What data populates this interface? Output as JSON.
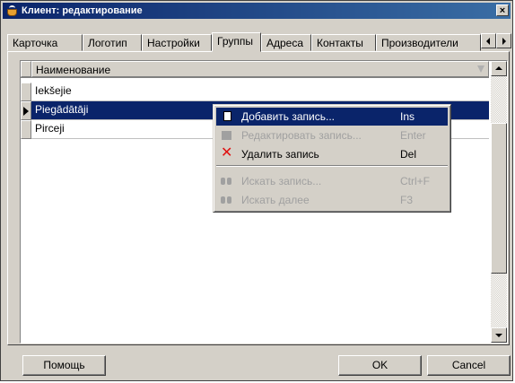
{
  "window": {
    "title": "Клиент: редактирование",
    "close_glyph": "×"
  },
  "tabs": [
    "Карточка",
    "Логотип",
    "Настройки",
    "Группы",
    "Адреса",
    "Контакты",
    "Производители"
  ],
  "active_tab": "Группы",
  "grid": {
    "column_header": "Наименование",
    "rows": [
      "Iekšejie",
      "Piegādātāji",
      "Pirceji"
    ],
    "selected_row": "Piegādātāji"
  },
  "context_menu": [
    {
      "label": "Добавить запись...",
      "shortcut": "Ins",
      "icon": "new-document-icon",
      "enabled": true,
      "highlighted": true
    },
    {
      "label": "Редактировать запись...",
      "shortcut": "Enter",
      "icon": "edit-document-icon",
      "enabled": false
    },
    {
      "label": "Удалить запись",
      "shortcut": "Del",
      "icon": "delete-x-icon",
      "enabled": true
    },
    {
      "separator": true
    },
    {
      "label": "Искать запись...",
      "shortcut": "Ctrl+F",
      "icon": "binoculars-icon",
      "enabled": false
    },
    {
      "label": "Искать далее",
      "shortcut": "F3",
      "icon": "find-next-icon",
      "enabled": false
    }
  ],
  "buttons": {
    "help": "Помощь",
    "ok": "OK",
    "cancel": "Cancel"
  },
  "colors": {
    "title_bar": "#0a246a",
    "selection": "#0a246a",
    "face": "#d4d0c8",
    "delete_icon": "#e01010"
  }
}
